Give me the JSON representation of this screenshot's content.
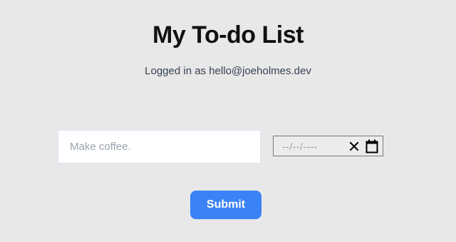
{
  "header": {
    "title": "My To-do List",
    "logged_in_text": "Logged in as hello@joeholmes.dev"
  },
  "form": {
    "todo_placeholder": "Make coffee.",
    "todo_value": "",
    "date_display": "--/--/----",
    "clear_icon": "close-icon",
    "calendar_icon": "calendar-icon",
    "submit_label": "Submit"
  },
  "colors": {
    "background": "#e8e8e8",
    "accent": "#3b82f6",
    "title_text": "#111111",
    "subtitle_text": "#374151"
  }
}
